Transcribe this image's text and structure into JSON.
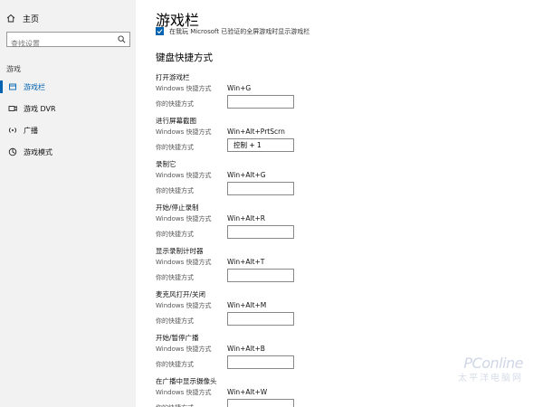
{
  "sidebar": {
    "home_label": "主页",
    "search_placeholder": "查找设置",
    "section_label": "游戏",
    "items": [
      {
        "label": "游戏栏",
        "icon": "game-bar-icon",
        "active": true
      },
      {
        "label": "游戏 DVR",
        "icon": "game-dvr-icon",
        "active": false
      },
      {
        "label": "广播",
        "icon": "broadcast-icon",
        "active": false
      },
      {
        "label": "游戏模式",
        "icon": "game-mode-icon",
        "active": false
      }
    ]
  },
  "main": {
    "title": "游戏栏",
    "checkbox_label": "在我玩 Microsoft 已验证的全屏游戏时显示游戏栏",
    "section_heading": "键盘快捷方式",
    "row_labels": {
      "windows": "Windows 快捷方式",
      "yours": "你的快捷方式"
    },
    "groups": [
      {
        "title": "打开游戏栏",
        "windows": "Win+G",
        "yours": ""
      },
      {
        "title": "进行屏幕截图",
        "windows": "Win+Alt+PrtScrn",
        "yours": "控制 + 1"
      },
      {
        "title": "录制它",
        "windows": "Win+Alt+G",
        "yours": ""
      },
      {
        "title": "开始/停止录制",
        "windows": "Win+Alt+R",
        "yours": ""
      },
      {
        "title": "显示录制计时器",
        "windows": "Win+Alt+T",
        "yours": ""
      },
      {
        "title": "麦克风打开/关闭",
        "windows": "Win+Alt+M",
        "yours": ""
      },
      {
        "title": "开始/暂停广播",
        "windows": "Win+Alt+B",
        "yours": ""
      },
      {
        "title": "在广播中显示摄像头",
        "windows": "Win+Alt+W",
        "yours": ""
      }
    ]
  },
  "watermark": {
    "brand": "PConline",
    "cn": "太平洋电脑网"
  },
  "colors": {
    "accent": "#0063b1",
    "sidebar_bg": "#f2f2f2"
  }
}
